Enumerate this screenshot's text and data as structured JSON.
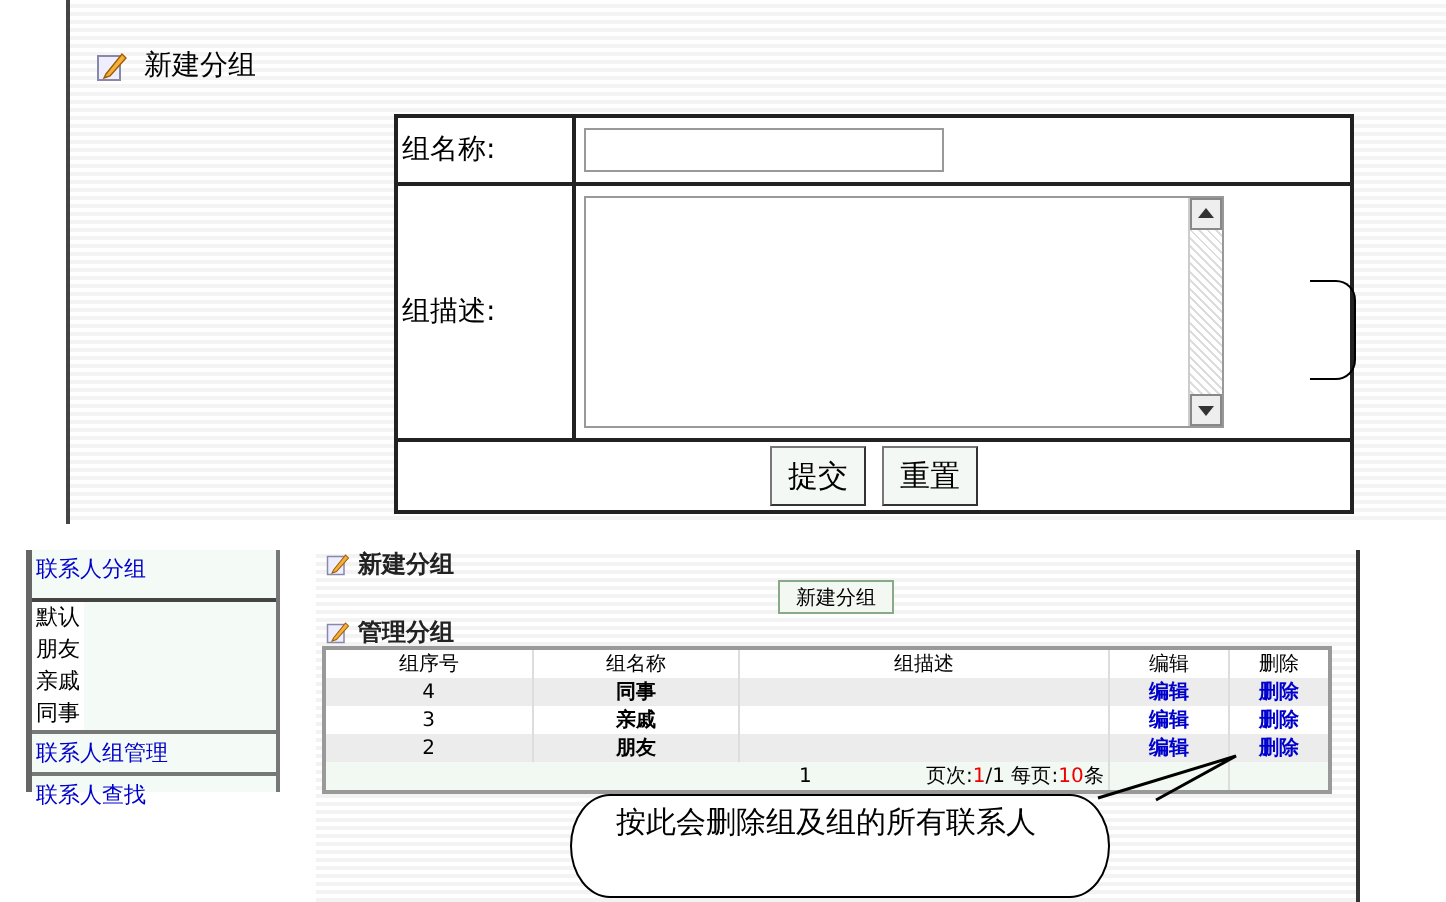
{
  "top_form": {
    "title": "新建分组",
    "fields": [
      {
        "label": "组名称:",
        "kind": "text"
      },
      {
        "label": "组描述:",
        "kind": "textarea"
      }
    ],
    "buttons": [
      "提交",
      "重置"
    ]
  },
  "sidebar": {
    "header": "联系人分组",
    "groups": [
      "默认",
      "朋友",
      "亲戚",
      "同事"
    ],
    "links": [
      "联系人组管理",
      "联系人查找"
    ]
  },
  "main": {
    "new_title": "新建分组",
    "new_button": "新建分组",
    "manage_title": "管理分组",
    "table": {
      "columns": [
        "组序号",
        "组名称",
        "组描述",
        "编辑",
        "删除"
      ],
      "rows": [
        {
          "id": "4",
          "name": "同事",
          "edit": "编辑",
          "delete": "删除"
        },
        {
          "id": "3",
          "name": "亲戚",
          "edit": "编辑",
          "delete": "删除"
        },
        {
          "id": "2",
          "name": "朋友",
          "edit": "编辑",
          "delete": "删除"
        }
      ],
      "footer": {
        "page_number": "1",
        "page_label": "页次:",
        "current": "1",
        "total": "/1",
        "per_page_label": " 每页:",
        "per_page": "10",
        "unit": "条"
      }
    }
  },
  "callout": "按此会删除组及组的所有联系人"
}
